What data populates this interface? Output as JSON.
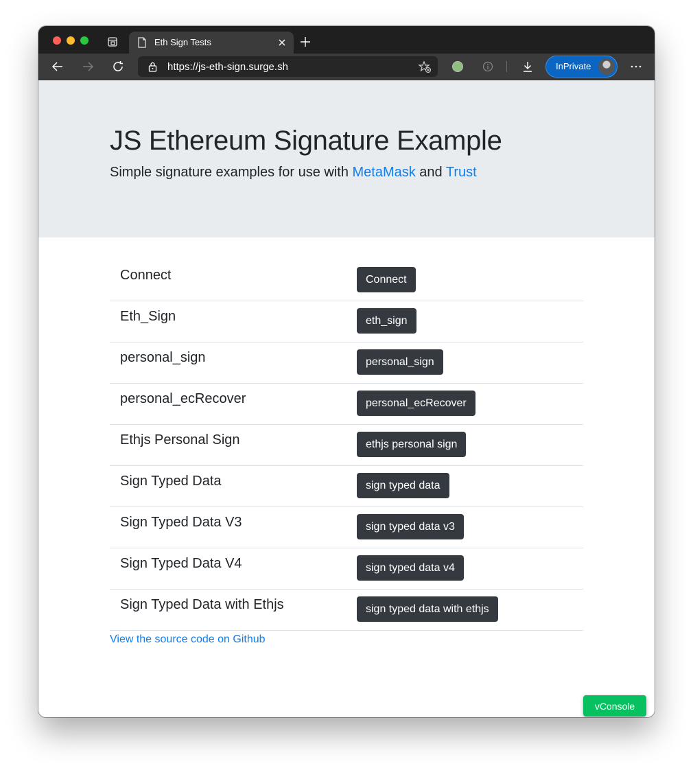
{
  "browser": {
    "tab_title": "Eth Sign Tests",
    "url": "https://js-eth-sign.surge.sh",
    "inprivate_label": "InPrivate",
    "icons": {
      "tab_actions": "tab-actions-icon",
      "page": "page-icon",
      "close": "close-icon",
      "new_tab": "plus-icon",
      "back": "back-arrow-icon",
      "forward": "forward-arrow-icon",
      "refresh": "refresh-icon",
      "lock": "lock-icon",
      "favorite": "add-favorite-icon",
      "extension": "extension-icon",
      "info": "info-icon",
      "downloads": "download-icon",
      "more": "more-icon"
    }
  },
  "page": {
    "title": "JS Ethereum Signature Example",
    "lead_prefix": "Simple signature examples for use with ",
    "lead_link1": "MetaMask",
    "lead_and": " and ",
    "lead_link2": "Trust",
    "rows": [
      {
        "label": "Connect",
        "button": "Connect"
      },
      {
        "label": "Eth_Sign",
        "button": "eth_sign"
      },
      {
        "label": "personal_sign",
        "button": "personal_sign"
      },
      {
        "label": "personal_ecRecover",
        "button": "personal_ecRecover"
      },
      {
        "label": "Ethjs Personal Sign",
        "button": "ethjs personal sign"
      },
      {
        "label": "Sign Typed Data",
        "button": "sign typed data"
      },
      {
        "label": "Sign Typed Data V3",
        "button": "sign typed data v3"
      },
      {
        "label": "Sign Typed Data V4",
        "button": "sign typed data v4"
      },
      {
        "label": "Sign Typed Data with Ethjs",
        "button": "sign typed data with ethjs"
      }
    ],
    "source_link": "View the source code on Github",
    "vconsole_label": "vConsole"
  },
  "colors": {
    "jumbotron_bg": "#e9ecef",
    "button_dark": "#343a40",
    "link_blue": "#0d7ff0",
    "vconsole_green": "#07c160",
    "inprivate_blue": "#0a66c2"
  }
}
